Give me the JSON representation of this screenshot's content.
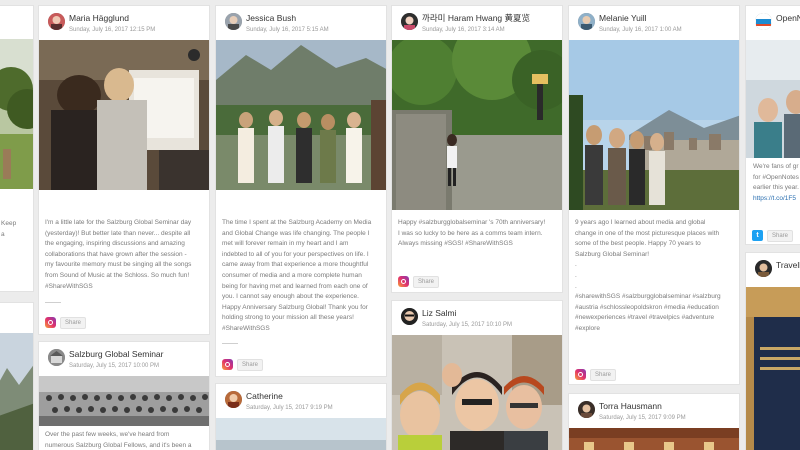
{
  "colors": {
    "background": "#ececec",
    "card": "#ffffff",
    "instagram": "#e1306c",
    "twitter": "#1da1f2"
  },
  "share_label": "Share",
  "left_partial": {
    "text": [
      "Keep",
      "a"
    ]
  },
  "posts": [
    {
      "author": "Maria Hägglund",
      "date": "Sunday, July 16, 2017 12:15 PM",
      "source_icon": "instagram-icon",
      "text": [
        "I'm a little late for the Salzburg Global Seminar day",
        "(yesterday)! But better late than never... despite all",
        "the engaging, inspiring discussions and amazing",
        "collaborations that have grown after the session -",
        "my favourite memory must be singing all the songs",
        "from Sound of Music at the Schloss. So much fun!",
        "#ShareWithSGS"
      ]
    },
    {
      "author": "Salzburg Global Seminar",
      "date": "Saturday, July 15, 2017 10:00 PM",
      "text": [
        "Over the past few weeks, we've heard from",
        "numerous Salzburg Global Fellows, and it's been a"
      ]
    },
    {
      "author": "Jessica Bush",
      "date": "Sunday, July 16, 2017 5:15 AM",
      "source_icon": "instagram-icon",
      "text": [
        "The time I spent at the Salzburg Academy on Media",
        "and Global Change was life changing. The people I",
        "met will forever remain in my heart and I am",
        "indebted to all of you for your perspectives on life. I",
        "came away from that experience a more thoughtful",
        "consumer of media and a more complete human",
        "being for having met and learned from each one of",
        "you. I cannot say enough about the experience.",
        "Happy Anniversary Salzburg Global! Thank you for",
        "holding strong to your mission all these years!",
        "#ShareWithSGS"
      ]
    },
    {
      "author": "Catherine",
      "date": "Saturday, July 15, 2017 9:19 PM"
    },
    {
      "author": "까라미 Haram Hwang 黄夏览",
      "date": "Sunday, July 16, 2017 3:14 AM",
      "source_icon": "instagram-icon",
      "text": [
        "Happy #salzburgglobalseminar 's 70th anniversary!",
        "I was so lucky to be here as a comms team intern.",
        "Always missing #SGS! #ShareWithSGS"
      ]
    },
    {
      "author": "Liz Salmi",
      "date": "Saturday, July 15, 2017 10:10 PM"
    },
    {
      "author": "Melanie Yuill",
      "date": "Sunday, July 16, 2017 1:00 AM",
      "source_icon": "instagram-icon",
      "text": [
        "9 years ago I learned about media and global",
        "change in one of the most picturesque places with",
        "some of the best people. Happy 70 years to",
        "Salzburg Global Seminar!",
        ".",
        ".",
        ".",
        "#sharewithSGS #salzburgglobalseminar #salzburg",
        "#austria #schlossleopoldskron #media #education",
        "#newexperiences #travel #travelpics #adventure",
        "#explore"
      ]
    },
    {
      "author": "Torra Hausmann",
      "date": "Saturday, July 15, 2017 9:09 PM"
    },
    {
      "author": "OpenN",
      "date": "",
      "source_icon": "twitter-icon",
      "text": [
        "We're fans of gr",
        "for #OpenNotes",
        "earlier this year.",
        "https://t.co/1F5"
      ]
    },
    {
      "author": "Travell",
      "date": ""
    }
  ]
}
